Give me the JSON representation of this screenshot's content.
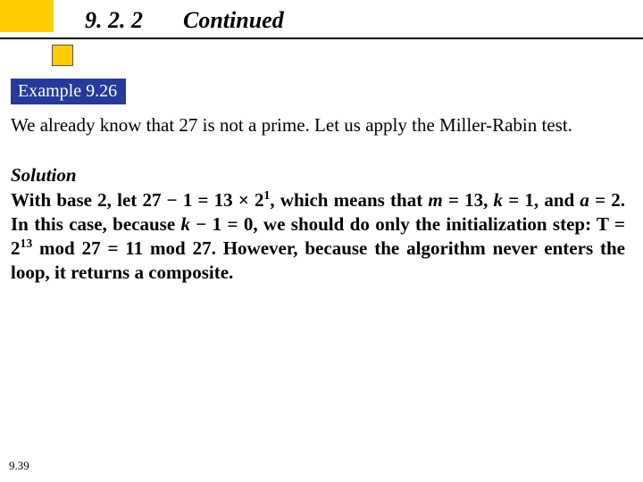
{
  "header": {
    "section": "9. 2. 2",
    "continued": "Continued"
  },
  "example": {
    "label": "Example 9.26",
    "problem": "We already know that 27 is not a prime. Let us apply the Miller-Rabin test."
  },
  "solution": {
    "heading": "Solution",
    "l1a": "With base 2, let 27 − 1 = 13 × 2",
    "l1exp": "1",
    "l1b": ", which means that ",
    "m": "m",
    "eqm": " = 13, ",
    "k": "k",
    "eqk": " = 1, and ",
    "a": "a",
    "eqa": " = 2. In this case, because ",
    "k2": "k",
    "l2": " − 1 = 0, we should do only the initialization step: T = 2",
    "l2exp": "13",
    "l3": " mod 27 = 11 mod 27. However, because the algorithm never enters the loop, it returns a composite."
  },
  "page": "9.39"
}
